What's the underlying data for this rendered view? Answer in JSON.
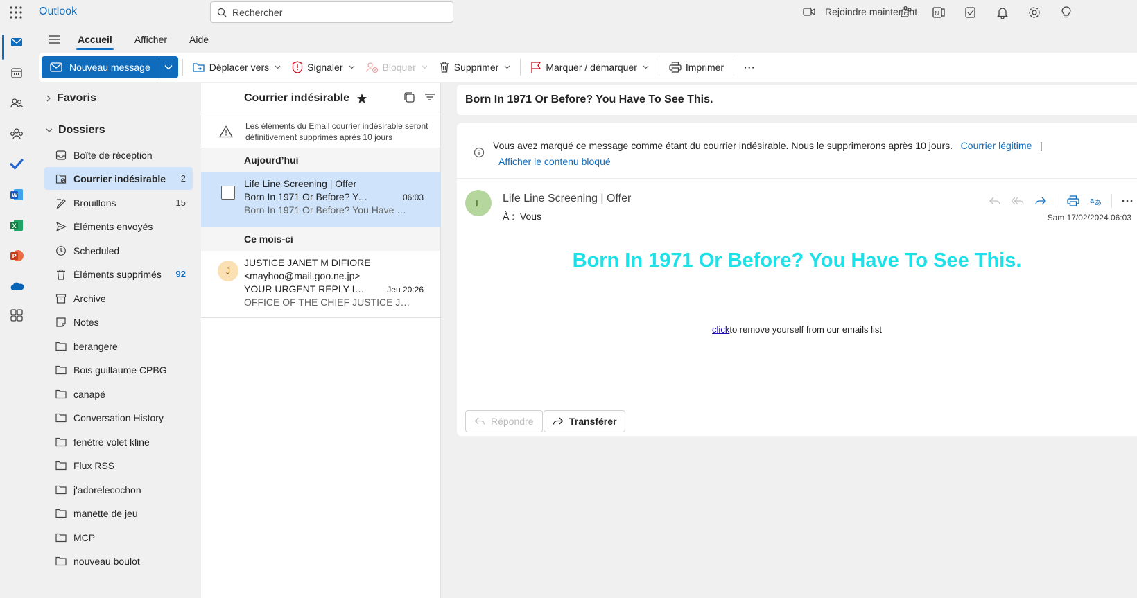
{
  "app": {
    "name": "Outlook"
  },
  "search": {
    "placeholder": "Rechercher"
  },
  "topbar": {
    "join_label": "Rejoindre maintenant"
  },
  "ribbon": {
    "tabs": [
      "Accueil",
      "Afficher",
      "Aide"
    ],
    "new_message": "Nouveau message",
    "move_to": "Déplacer vers",
    "report": "Signaler",
    "block": "Bloquer",
    "delete": "Supprimer",
    "flag": "Marquer / démarquer",
    "print": "Imprimer",
    "more": "···"
  },
  "folders": {
    "favorites_label": "Favoris",
    "folders_label": "Dossiers",
    "items": [
      {
        "name": "Boîte de réception",
        "count": "",
        "icon": "inbox-icon"
      },
      {
        "name": "Courrier indésirable",
        "count": "2",
        "icon": "junk-icon",
        "selected": true
      },
      {
        "name": "Brouillons",
        "count": "15",
        "icon": "pencil-icon"
      },
      {
        "name": "Éléments envoyés",
        "count": "",
        "icon": "send-icon"
      },
      {
        "name": "Scheduled",
        "count": "",
        "icon": "clock-icon"
      },
      {
        "name": "Éléments supprimés",
        "count": "92",
        "icon": "trash-icon"
      },
      {
        "name": "Archive",
        "count": "",
        "icon": "archive-icon"
      },
      {
        "name": "Notes",
        "count": "",
        "icon": "note-icon"
      },
      {
        "name": "berangere",
        "count": "",
        "icon": "folder-icon"
      },
      {
        "name": "Bois guillaume CPBG",
        "count": "",
        "icon": "folder-icon"
      },
      {
        "name": "canapé",
        "count": "",
        "icon": "folder-icon"
      },
      {
        "name": "Conversation History",
        "count": "",
        "icon": "folder-icon"
      },
      {
        "name": "fenètre volet kline",
        "count": "",
        "icon": "folder-icon"
      },
      {
        "name": "Flux RSS",
        "count": "",
        "icon": "folder-icon"
      },
      {
        "name": "j'adorelecochon",
        "count": "",
        "icon": "folder-icon"
      },
      {
        "name": "manette de jeu",
        "count": "",
        "icon": "folder-icon"
      },
      {
        "name": "MCP",
        "count": "",
        "icon": "folder-icon"
      },
      {
        "name": "nouveau boulot",
        "count": "",
        "icon": "folder-icon"
      }
    ]
  },
  "message_list": {
    "title": "Courrier indésirable",
    "junk_notice": "Les éléments du Email courrier indésirable seront définitivement supprimés après 10 jours",
    "groups": [
      {
        "label": "Aujourd’hui",
        "messages": [
          {
            "sender": "Life Line Screening | Offer",
            "subject": "Born In 1971 Or Before? You ...",
            "time": "06:03",
            "preview": "Born In 1971 Or Before? You Have To ..."
          }
        ]
      },
      {
        "label": "Ce mois-ci",
        "messages": [
          {
            "avatar": "J",
            "sender": "JUSTICE JANET M DIFIORE",
            "sender_email": "<mayhoo@mail.goo.ne.jp>",
            "subject": "YOUR URGENT REPLY IS N...",
            "time": "Jeu 20:26",
            "preview": "OFFICE OF THE CHIEF JUSTICE JANET..."
          }
        ]
      }
    ]
  },
  "reading_pane": {
    "subject": "Born In 1971 Or Before? You Have To See This.",
    "warning": "Vous avez marqué ce message comme étant du courrier indésirable. Nous le supprimerons après 10 jours.",
    "legit_link": "Courrier légitime",
    "separator": "|",
    "show_blocked": "Afficher le contenu bloqué",
    "avatar": "L",
    "from": "Life Line Screening | Offer",
    "to_label": "À :",
    "to": "Vous",
    "date": "Sam 17/02/2024 06:03",
    "body_title": "Born In 1971 Or Before? You Have To See This.",
    "unsub_link": "click",
    "unsub_text": "to remove yourself from our emails list",
    "reply": "Répondre",
    "forward": "Transférer"
  },
  "colors": {
    "accent": "#0f6cbd",
    "body_title": "#1ee0e8",
    "selected": "#cfe4fa"
  }
}
